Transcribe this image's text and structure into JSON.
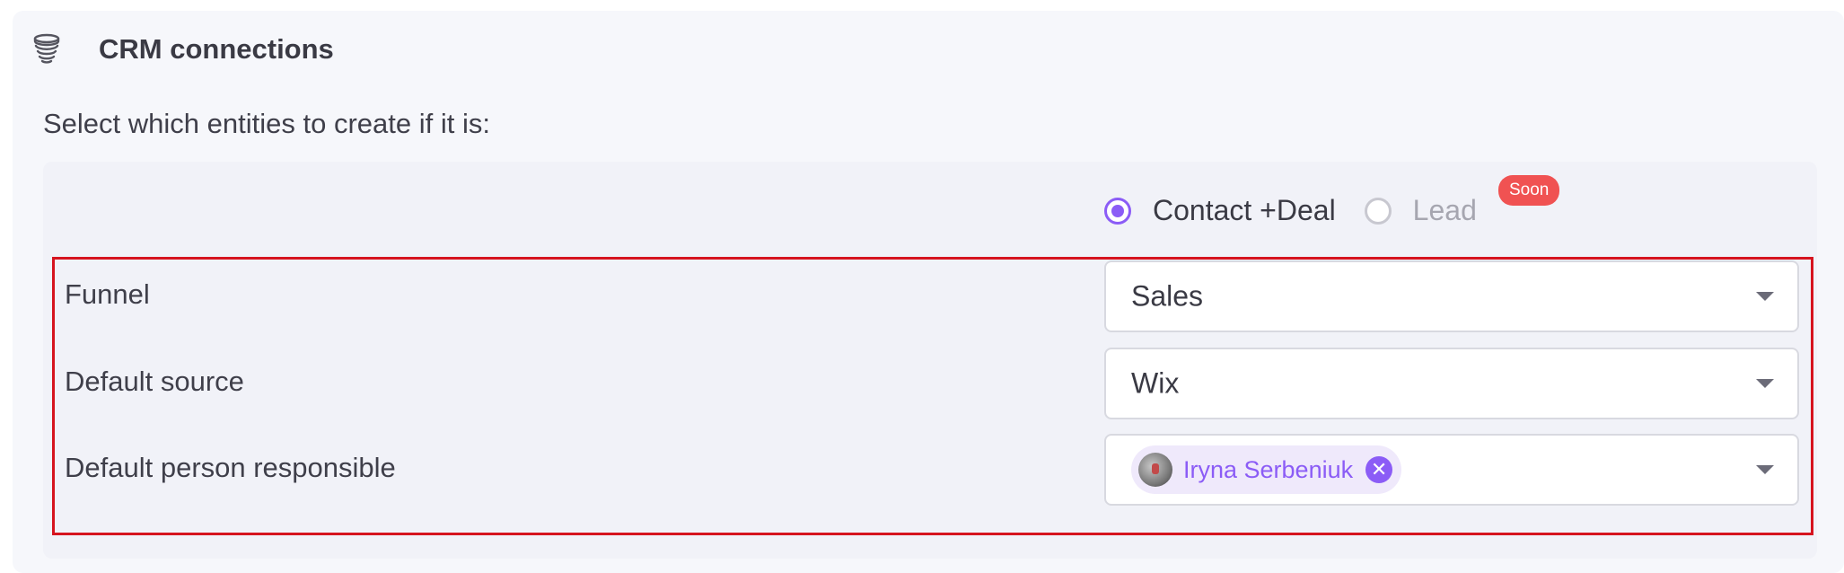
{
  "section": {
    "title": "CRM connections",
    "icon": "database-stack-icon",
    "subtitle": "Select which entities to create if it is:"
  },
  "entity_options": [
    {
      "label": "Contact +Deal",
      "selected": true
    },
    {
      "label": "Lead",
      "selected": false,
      "disabled": true,
      "badge": "Soon"
    }
  ],
  "fields": {
    "funnel": {
      "label": "Funnel",
      "value": "Sales"
    },
    "default_source": {
      "label": "Default source",
      "value": "Wix"
    },
    "default_person": {
      "label": "Default person responsible",
      "chip": {
        "name": "Iryna Serbeniuk",
        "remove_symbol": "✕"
      }
    }
  },
  "colors": {
    "accent": "#8b5cf6",
    "badge": "#f05252",
    "highlight_border": "#d6141f",
    "card_bg": "#f6f7fb"
  }
}
